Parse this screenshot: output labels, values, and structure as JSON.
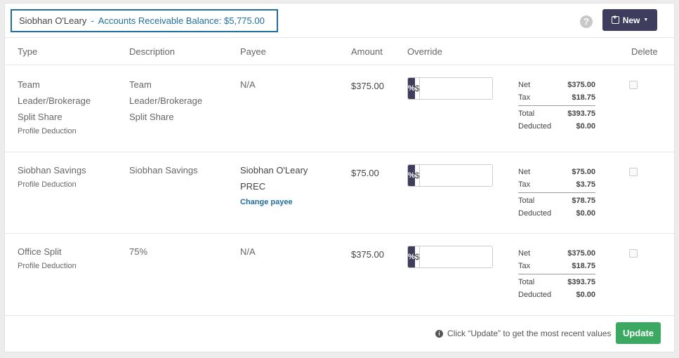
{
  "header": {
    "name": "Siobhan O'Leary",
    "separator": "-",
    "balance": "Accounts Receivable Balance: $5,775.00",
    "help_glyph": "?",
    "new_label": "New"
  },
  "columns": {
    "type": "Type",
    "description": "Description",
    "payee": "Payee",
    "amount": "Amount",
    "override": "Override",
    "delete": "Delete"
  },
  "override_labels": {
    "percent": "%",
    "dollar": "$"
  },
  "summary_labels": {
    "net": "Net",
    "tax": "Tax",
    "total": "Total",
    "deducted": "Deducted"
  },
  "rows": [
    {
      "type_lines": [
        "Team",
        "Leader/Brokerage",
        "Split Share"
      ],
      "type_sub": "Profile Deduction",
      "description_lines": [
        "Team",
        "Leader/Brokerage",
        "Split Share"
      ],
      "payee": "N/A",
      "amount": "$375.00",
      "net": "$375.00",
      "tax": "$18.75",
      "total": "$393.75",
      "deducted": "$0.00"
    },
    {
      "type_lines": [
        "Siobhan Savings"
      ],
      "type_sub": "Profile Deduction",
      "description_lines": [
        "Siobhan Savings"
      ],
      "payee_lines": [
        "Siobhan O'Leary",
        "PREC"
      ],
      "payee_link": "Change payee",
      "amount": "$75.00",
      "net": "$75.00",
      "tax": "$3.75",
      "total": "$78.75",
      "deducted": "$0.00"
    },
    {
      "type_lines": [
        "Office Split"
      ],
      "type_sub": "Profile Deduction",
      "description_lines": [
        "75%"
      ],
      "payee": "N/A",
      "amount": "$375.00",
      "net": "$375.00",
      "tax": "$18.75",
      "total": "$393.75",
      "deducted": "$0.00"
    }
  ],
  "footer": {
    "info_glyph": "i",
    "note": "Click “Update” to get the most recent values",
    "update_label": "Update"
  }
}
